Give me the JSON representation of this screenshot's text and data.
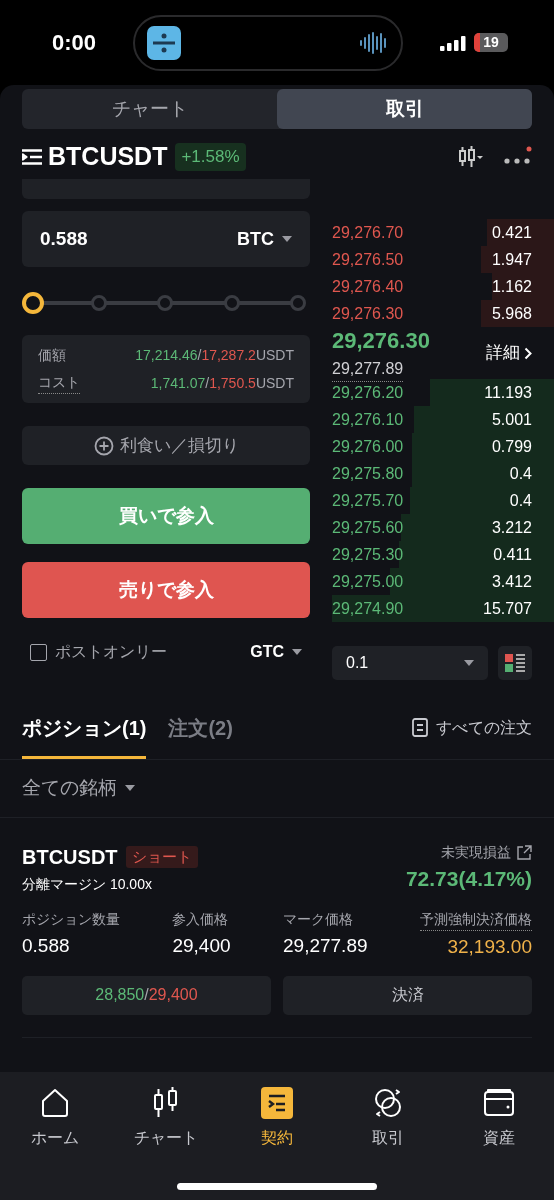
{
  "status_bar": {
    "time": "0:00",
    "battery": "19"
  },
  "segment_tabs": [
    {
      "label": "チャート",
      "selected": false
    },
    {
      "label": "取引",
      "selected": true
    }
  ],
  "symbol": {
    "name": "BTCUSDT",
    "change": "+1.58%"
  },
  "order_form": {
    "quantity": "0.588",
    "unit": "BTC",
    "slider": {
      "level": 0
    },
    "summary": [
      {
        "label": "価額",
        "buy": "17,214.46",
        "separator": "/",
        "sell": "17,287.2",
        "unit": "USDT",
        "dotted": false
      },
      {
        "label": "コスト",
        "buy": "1,741.07",
        "separator": "/",
        "sell": "1,750.5",
        "unit": "USDT",
        "dotted": true
      }
    ],
    "tp_sl": "利食い／損切り",
    "buy_button": "買いで参入",
    "sell_button": "売りで参入",
    "post_only": {
      "label": "ポストオンリー",
      "checked": false
    },
    "time_in_force": "GTC"
  },
  "order_book": {
    "asks": [
      {
        "price": "29,276.70",
        "amount": "0.421"
      },
      {
        "price": "29,276.50",
        "amount": "1.947"
      },
      {
        "price": "29,276.40",
        "amount": "1.162"
      },
      {
        "price": "29,276.30",
        "amount": "5.968"
      }
    ],
    "last_price": "29,276.30",
    "mark_price": "29,277.89",
    "details": "詳細",
    "bids": [
      {
        "price": "29,276.20",
        "amount": "11.193"
      },
      {
        "price": "29,276.10",
        "amount": "5.001"
      },
      {
        "price": "29,276.00",
        "amount": "0.799"
      },
      {
        "price": "29,275.80",
        "amount": "0.4"
      },
      {
        "price": "29,275.70",
        "amount": "0.4"
      },
      {
        "price": "29,275.60",
        "amount": "3.212"
      },
      {
        "price": "29,275.30",
        "amount": "0.411"
      },
      {
        "price": "29,275.00",
        "amount": "3.412"
      },
      {
        "price": "29,274.90",
        "amount": "15.707"
      }
    ],
    "precision": "0.1"
  },
  "position_tabs": [
    {
      "label": "ポジション(1)",
      "selected": true
    },
    {
      "label": "注文(2)",
      "selected": false
    }
  ],
  "all_orders": "すべての注文",
  "filter": "全ての銘柄",
  "position": {
    "symbol": "BTCUSDT",
    "side": "ショート",
    "margin": "分離マージン 10.00x",
    "pnl_label": "未実現損益",
    "pnl": "72.73(4.17%)",
    "fields": [
      {
        "label": "ポジション数量",
        "value": "0.588",
        "kind": "plain"
      },
      {
        "label": "参入価格",
        "value": "29,400",
        "kind": "plain"
      },
      {
        "label": "マーク価格",
        "value": "29,277.89",
        "kind": "plain"
      },
      {
        "label": "予測強制決済価格",
        "value": "32,193.00",
        "kind": "warning"
      }
    ],
    "take_profit": "28,850",
    "separator": "/",
    "stop_loss": "29,400",
    "close": "決済"
  },
  "nav": [
    {
      "label": "ホーム",
      "selected": false
    },
    {
      "label": "チャート",
      "selected": false
    },
    {
      "label": "契約",
      "selected": true
    },
    {
      "label": "取引",
      "selected": false
    },
    {
      "label": "資産",
      "selected": false
    }
  ]
}
